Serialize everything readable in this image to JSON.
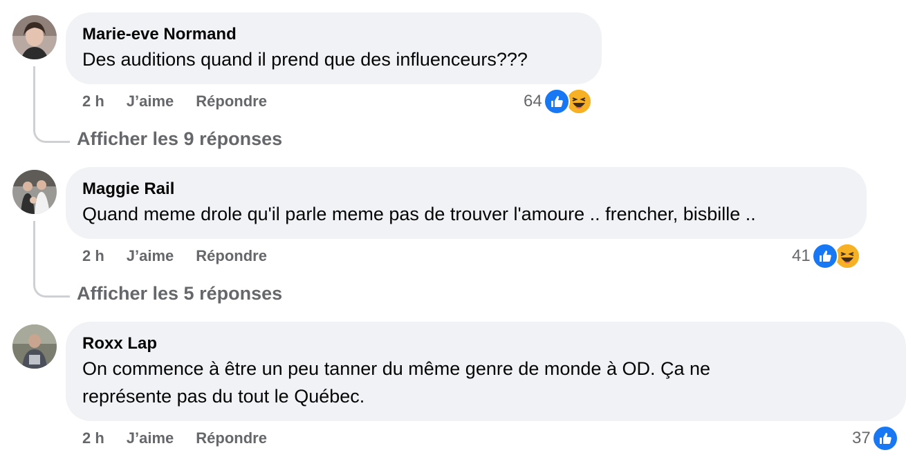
{
  "comments": [
    {
      "author": "Marie-eve Normand",
      "text": "Des auditions quand il prend que des influenceurs???",
      "time": "2 h",
      "like_label": "J’aime",
      "reply_label": "Répondre",
      "reaction_count": "64",
      "reactions": [
        "like-icon",
        "haha-icon"
      ],
      "replies_link": "Afficher les 9 réponses"
    },
    {
      "author": "Maggie Rail",
      "text": "Quand meme drole qu'il parle meme pas de trouver l'amoure .. frencher, bisbille ..",
      "time": "2 h",
      "like_label": "J’aime",
      "reply_label": "Répondre",
      "reaction_count": "41",
      "reactions": [
        "like-icon",
        "haha-icon"
      ],
      "replies_link": "Afficher les 5 réponses"
    },
    {
      "author": "Roxx Lap",
      "text_line1": "On commence à être un peu tanner du même genre de monde à OD. Ça ne",
      "text_line2": "représente pas du tout le Québec.",
      "time": "2 h",
      "like_label": "J’aime",
      "reply_label": "Répondre",
      "reaction_count": "37",
      "reactions": [
        "like-icon"
      ]
    }
  ],
  "colors": {
    "bubble": "#f0f2f5",
    "meta_text": "#65676b",
    "like_blue": "#1877f2",
    "haha_yellow": "#f7b125",
    "thread_line": "#ced0d4"
  }
}
